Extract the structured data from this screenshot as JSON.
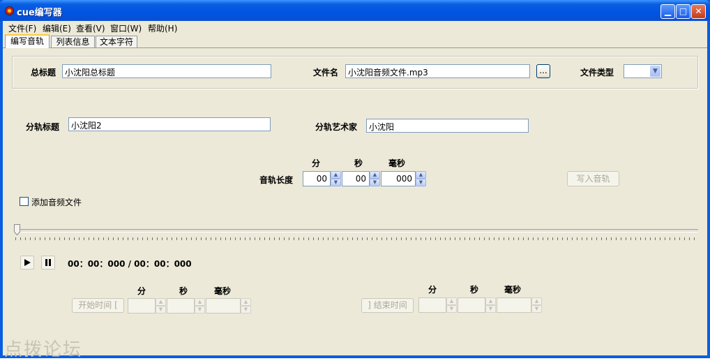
{
  "window": {
    "title": "cue编写器"
  },
  "menu": [
    "文件(F)",
    "编辑(E)",
    "查看(V)",
    "窗口(W)",
    "帮助(H)"
  ],
  "tabs": [
    "编写音轨",
    "列表信息",
    "文本字符"
  ],
  "album": {
    "title_label": "总标题",
    "title_value": "小沈阳总标题",
    "file_label": "文件名",
    "file_value": "小沈阳音频文件.mp3",
    "browse_label": "...",
    "type_label": "文件类型",
    "type_value": ""
  },
  "track": {
    "title_label": "分轨标题",
    "title_value": "小沈阳2",
    "artist_label": "分轨艺术家",
    "artist_value": "小沈阳",
    "length_label": "音轨长度",
    "min_header": "分",
    "sec_header": "秒",
    "ms_header": "毫秒",
    "min_value": "00",
    "sec_value": "00",
    "ms_value": "000",
    "write_button": "写入音轨"
  },
  "add_audio": {
    "label": "添加音频文件",
    "checked": false
  },
  "player": {
    "play_icon": "play-icon",
    "pause_icon": "pause-icon",
    "time_display": "00：00：000 / 00：00：000",
    "position": 0
  },
  "start_time": {
    "button": "开始时间 [",
    "min_header": "分",
    "sec_header": "秒",
    "ms_header": "毫秒",
    "min_value": "",
    "sec_value": "",
    "ms_value": ""
  },
  "end_time": {
    "button": "] 结束时间",
    "min_header": "分",
    "sec_header": "秒",
    "ms_header": "毫秒",
    "min_value": "",
    "sec_value": "",
    "ms_value": ""
  },
  "watermark": "点拨论坛"
}
